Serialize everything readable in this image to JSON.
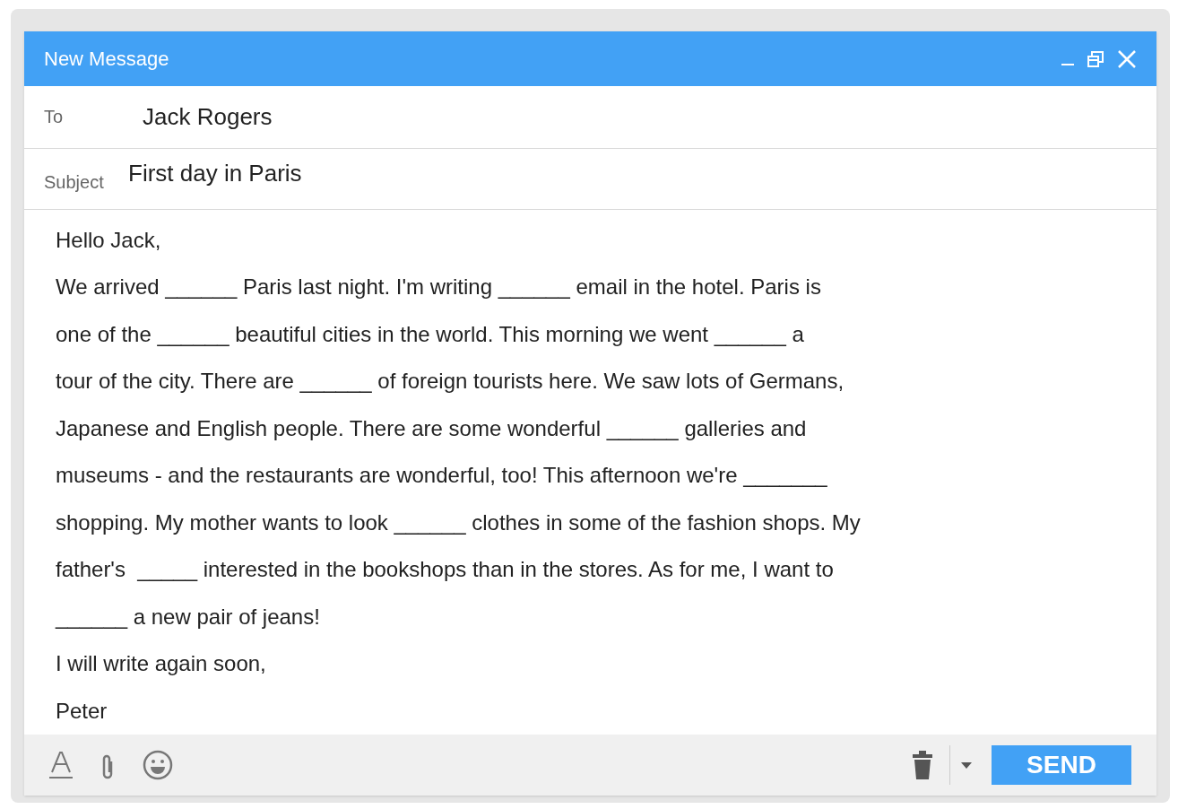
{
  "window": {
    "title": "New Message"
  },
  "to": {
    "label": "To",
    "value": "Jack Rogers"
  },
  "subject": {
    "label": "Subject",
    "value": "First day in Paris"
  },
  "body": {
    "lines": [
      "Hello Jack,",
      "We arrived ______ Paris last night. I'm writing ______ email in the hotel. Paris is",
      "one of the ______ beautiful cities in the world. This morning we went ______ a",
      "tour of the city. There are ______ of foreign tourists here. We saw lots of Germans,",
      "Japanese and English people. There are some wonderful ______ galleries and",
      "museums - and the restaurants are wonderful, too! This afternoon we're _______",
      "shopping. My mother wants to look ______ clothes in some of the fashion shops. My",
      "father's  _____ interested in the bookshops than in the stores. As for me, I want to",
      "______ a new pair of jeans!",
      "I will write again soon,",
      "Peter"
    ]
  },
  "send_button": "SEND"
}
